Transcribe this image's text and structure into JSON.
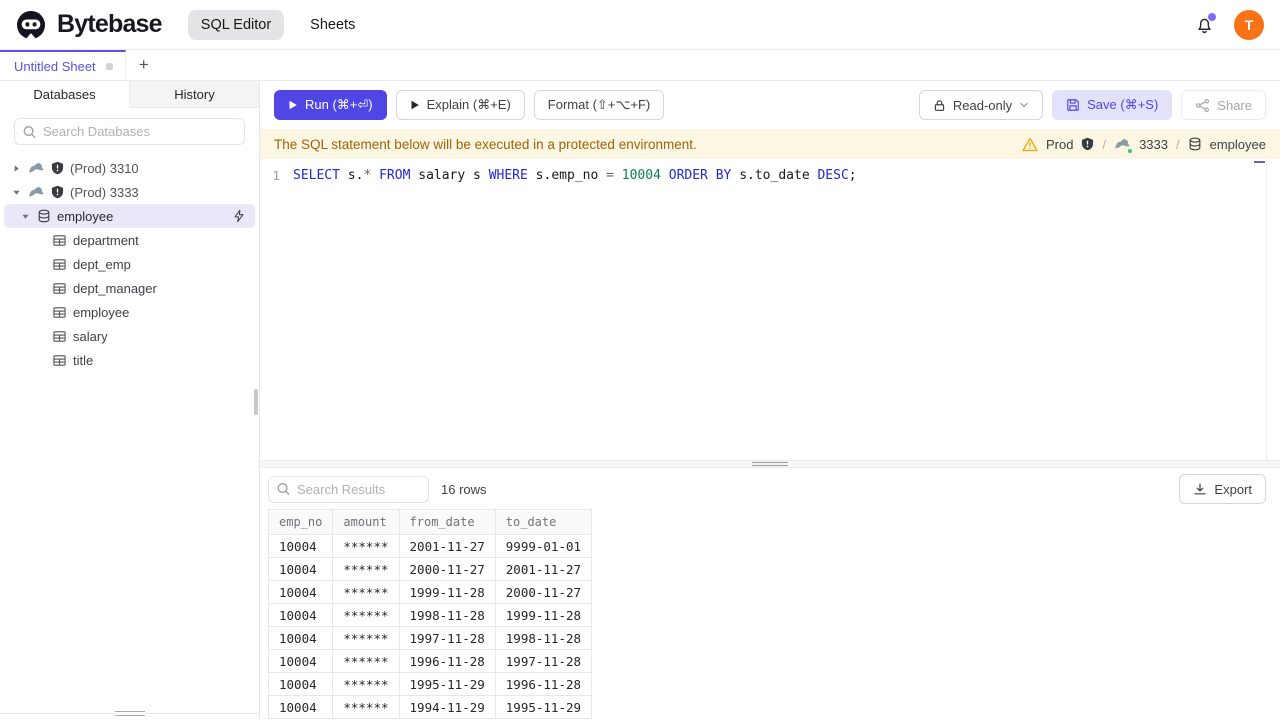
{
  "palette": {
    "accent": "#4f46e5",
    "accent-soft": "#e4e1fb",
    "tab-purple": "#5b50e6",
    "avatar-orange": "#f97316",
    "banner-bg": "#fcf7e3",
    "banner-text": "#a16207",
    "selected-row": "#e9e8f8",
    "kw": "#2328d0",
    "num": "#0d8050",
    "op": "#5f6672",
    "warning": "#f0a40c",
    "status-green": "#34c77b"
  },
  "header": {
    "brand": "Bytebase",
    "nav_sql_editor": "SQL Editor",
    "nav_sheets": "Sheets",
    "avatar_initial": "T"
  },
  "tabs": {
    "sheet_title": "Untitled Sheet",
    "add_label": "+"
  },
  "sidebar": {
    "tab_databases": "Databases",
    "tab_history": "History",
    "search_placeholder": "Search Databases",
    "instances": [
      "(Prod) 3310",
      "(Prod) 3333"
    ],
    "database": "employee",
    "tables": [
      "department",
      "dept_emp",
      "dept_manager",
      "employee",
      "salary",
      "title"
    ]
  },
  "toolbar": {
    "run": "Run (⌘+⏎)",
    "explain": "Explain (⌘+E)",
    "format": "Format (⇧+⌥+F)",
    "readonly": "Read-only",
    "save": "Save (⌘+S)",
    "share": "Share"
  },
  "banner": {
    "message": "The SQL statement below will be executed in a protected environment.",
    "environment": "Prod",
    "separator": "/",
    "instance": "3333",
    "database": "employee"
  },
  "editor": {
    "line_number": "1",
    "sql": "SELECT s.* FROM salary s WHERE s.emp_no = 10004 ORDER BY s.to_date DESC;",
    "tokens": [
      {
        "text": "SELECT",
        "type": "kw"
      },
      {
        "text": " s.",
        "type": "id"
      },
      {
        "text": "*",
        "type": "op"
      },
      {
        "text": " ",
        "type": "id"
      },
      {
        "text": "FROM",
        "type": "kw"
      },
      {
        "text": " salary s ",
        "type": "id"
      },
      {
        "text": "WHERE",
        "type": "kw"
      },
      {
        "text": " s.emp_no ",
        "type": "id"
      },
      {
        "text": "=",
        "type": "op"
      },
      {
        "text": " ",
        "type": "id"
      },
      {
        "text": "10004",
        "type": "num"
      },
      {
        "text": " ",
        "type": "id"
      },
      {
        "text": "ORDER BY",
        "type": "kw"
      },
      {
        "text": " s.to_date ",
        "type": "id"
      },
      {
        "text": "DESC",
        "type": "kw"
      },
      {
        "text": ";",
        "type": "id"
      }
    ]
  },
  "results": {
    "search_placeholder": "Search Results",
    "row_count": "16 rows",
    "export_label": "Export",
    "columns": [
      "emp_no",
      "amount",
      "from_date",
      "to_date"
    ],
    "rows": [
      [
        "10004",
        "******",
        "2001-11-27",
        "9999-01-01"
      ],
      [
        "10004",
        "******",
        "2000-11-27",
        "2001-11-27"
      ],
      [
        "10004",
        "******",
        "1999-11-28",
        "2000-11-27"
      ],
      [
        "10004",
        "******",
        "1998-11-28",
        "1999-11-28"
      ],
      [
        "10004",
        "******",
        "1997-11-28",
        "1998-11-28"
      ],
      [
        "10004",
        "******",
        "1996-11-28",
        "1997-11-28"
      ],
      [
        "10004",
        "******",
        "1995-11-29",
        "1996-11-28"
      ],
      [
        "10004",
        "******",
        "1994-11-29",
        "1995-11-29"
      ]
    ]
  }
}
